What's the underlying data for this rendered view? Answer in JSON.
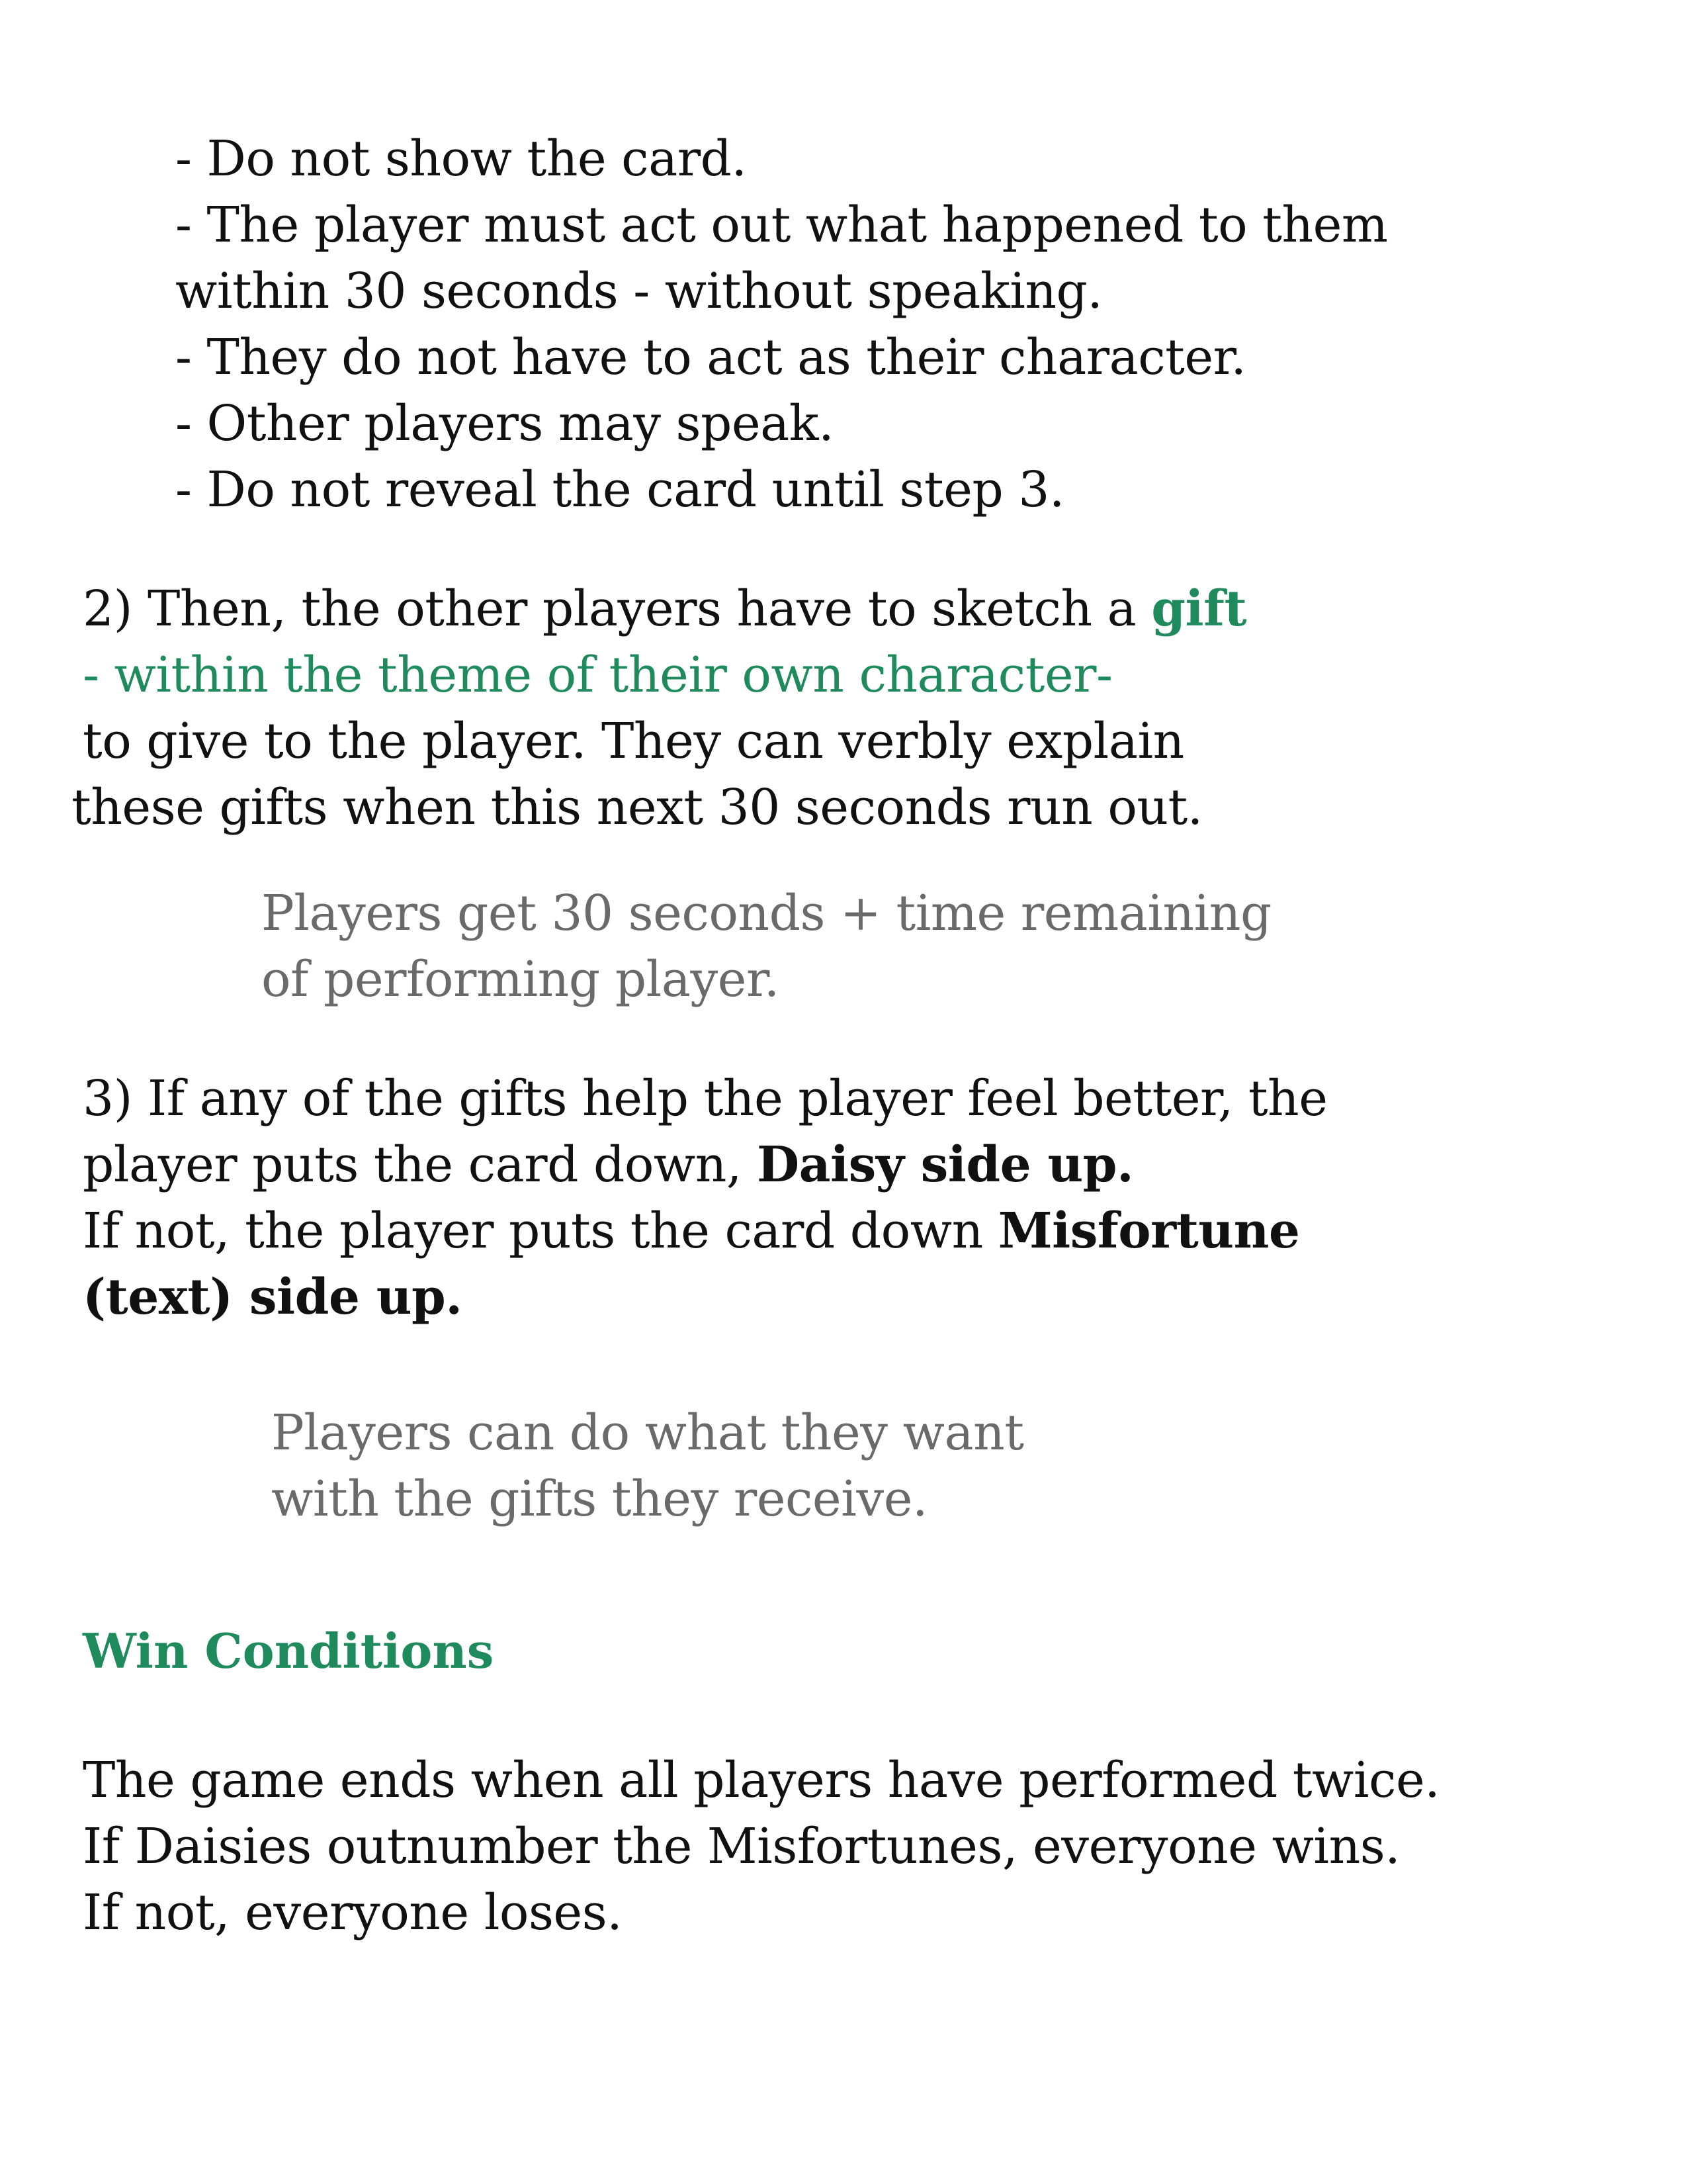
{
  "step1_bullets": [
    "- Do not show the card.",
    "- The player must act out what happened to them",
    "within 30 seconds - without speaking.",
    "- They do not have to act as their character.",
    "- Other players may speak.",
    "- Do not reveal the card until step 3."
  ],
  "step2": {
    "line1_text": "2) Then, the other players have to sketch a ",
    "line1_highlight": "gift",
    "line2": " - within the theme of their own character-",
    "line3": "to give to the player. They can verbly explain",
    "line4": "these gifts when this next 30 seconds run out.",
    "note_line1": "Players get 30 seconds + time remaining",
    "note_line2": "of performing player."
  },
  "step3": {
    "line1": "3) If any of the gifts help the player feel better, the",
    "line2_text": "player puts the card down, ",
    "line2_bold": "Daisy side up.",
    "line3_text": "If not, the player puts the card down ",
    "line3_bold": "Misfortune",
    "line4_bold": "(text) side up.",
    "note_line1": "Players can do what they want",
    "note_line2": "with the gifts they receive."
  },
  "win": {
    "heading": "Win Conditions",
    "line1": "The game ends when all players have performed twice.",
    "line2": "If Daisies outnumber the Misfortunes, everyone wins.",
    "line3": "If not, everyone loses."
  },
  "colors": {
    "accent_green": "#1f8a5b",
    "note_gray": "#6a6a6a",
    "text": "#111111"
  }
}
